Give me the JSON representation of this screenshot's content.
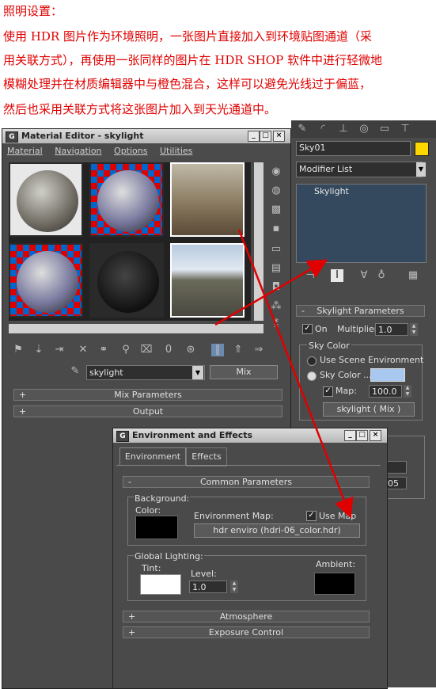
{
  "caption": {
    "lines": [
      "照明设置：",
      "使用 HDR 图片作为环境照明，一张图片直接加入到环境贴图通道（采",
      "用关联方式），再使用一张同样的图片在 HDR SHOP 软件中进行轻微地",
      "模糊处理并在材质编辑器中与橙色混合，这样可以避免光线过于偏蓝，",
      "然后也采用关联方式将这张图片加入到天光通道中。"
    ],
    "color": "#e00000"
  },
  "material_editor": {
    "title": "Material Editor - skylight",
    "menu": [
      "Material",
      "Navigation",
      "Options",
      "Utilities"
    ],
    "material_name": "skylight",
    "type_button": "Mix",
    "rollouts": [
      "Mix Parameters",
      "Output"
    ]
  },
  "command_panel": {
    "object_name": "Sky01",
    "object_color": "#ffd700",
    "modifier_list": "Modifier List",
    "stack_item": "Skylight",
    "skylight_params": {
      "title": "Skylight Parameters",
      "on_label": "On",
      "multiplier_label": "Multiplier:",
      "multiplier_value": "1.0",
      "sky_color_group": "Sky Color",
      "use_scene_env": "Use Scene Environment",
      "sky_color_label": "Sky Color ...",
      "sky_color_swatch": "#a8c8f0",
      "map_label": "Map:",
      "map_value": "100.0",
      "map_button": "skylight ( Mix )"
    },
    "partial_value": "05"
  },
  "env_dialog": {
    "title": "Environment and Effects",
    "tabs": [
      "Environment",
      "Effects"
    ],
    "common_params": "Common Parameters",
    "background_label": "Background:",
    "color_label": "Color:",
    "env_map_label": "Environment Map:",
    "use_map_label": "Use Map",
    "env_map_button": "hdr enviro (hdri-06_color.hdr)",
    "global_lighting_label": "Global Lighting:",
    "tint_label": "Tint:",
    "level_label": "Level:",
    "level_value": "1.0",
    "ambient_label": "Ambient:",
    "rollouts": [
      "Atmosphere",
      "Exposure Control"
    ]
  }
}
